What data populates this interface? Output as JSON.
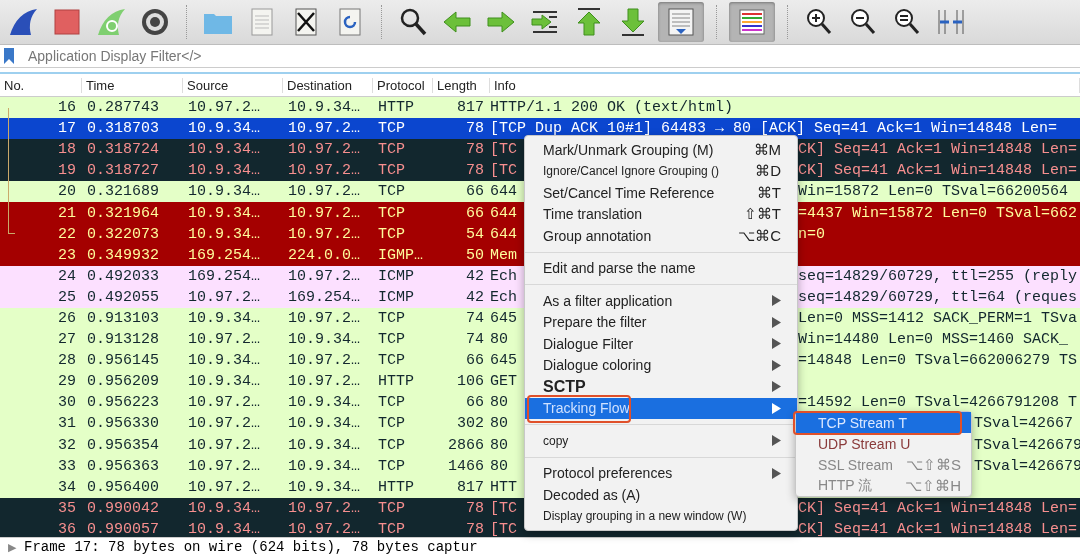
{
  "toolbar": [
    {
      "kind": "shark",
      "pressed": false
    },
    {
      "kind": "stop",
      "pressed": false
    },
    {
      "kind": "restart",
      "pressed": false
    },
    {
      "kind": "gear",
      "pressed": false
    },
    {
      "kind": "sep"
    },
    {
      "kind": "folder",
      "pressed": false
    },
    {
      "kind": "file",
      "pressed": false
    },
    {
      "kind": "close",
      "pressed": false
    },
    {
      "kind": "reload",
      "pressed": false
    },
    {
      "kind": "sep"
    },
    {
      "kind": "search",
      "pressed": false
    },
    {
      "kind": "left",
      "pressed": false
    },
    {
      "kind": "right",
      "pressed": false
    },
    {
      "kind": "goto",
      "pressed": false
    },
    {
      "kind": "top",
      "pressed": false
    },
    {
      "kind": "bottom",
      "pressed": false
    },
    {
      "kind": "autoscroll",
      "pressed": true
    },
    {
      "kind": "sep"
    },
    {
      "kind": "colorize",
      "pressed": true
    },
    {
      "kind": "sep"
    },
    {
      "kind": "zoomin",
      "pressed": false
    },
    {
      "kind": "zoomout",
      "pressed": false
    },
    {
      "kind": "zoomreset",
      "pressed": false
    },
    {
      "kind": "resize",
      "pressed": false
    }
  ],
  "filter": {
    "placeholder": "Application Display Filter</>"
  },
  "columns": [
    "No.",
    "Time",
    "Source",
    "Destination",
    "Protocol",
    "Length",
    "Info"
  ],
  "rows": [
    {
      "kind": "green",
      "related": true,
      "no": "16",
      "time": "0.287743",
      "source": "10.97.2…",
      "destination": "10.9.34…",
      "protocol": "HTTP",
      "length": "817",
      "info": "HTTP/1.1 200 OK  (text/html)"
    },
    {
      "kind": "selected",
      "related": true,
      "no": "17",
      "time": "0.318703",
      "source": "10.9.34…",
      "destination": "10.97.2…",
      "protocol": "TCP",
      "length": "78",
      "info": "[TCP Dup ACK 10#1] 64483 → 80 [ACK] Seq=41 Ack=1 Win=14848 Len="
    },
    {
      "kind": "dark",
      "related": true,
      "no": "18",
      "time": "0.318724",
      "source": "10.9.34…",
      "destination": "10.97.2…",
      "protocol": "TCP",
      "length": "78",
      "info": "[TC",
      "info_tail": "CK] Seq=41 Ack=1 Win=14848 Len="
    },
    {
      "kind": "dark",
      "related": true,
      "no": "19",
      "time": "0.318727",
      "source": "10.9.34…",
      "destination": "10.97.2…",
      "protocol": "TCP",
      "length": "78",
      "info": "[TC",
      "info_tail": "CK] Seq=41 Ack=1 Win=14848 Len="
    },
    {
      "kind": "green",
      "related": true,
      "no": "20",
      "time": "0.321689",
      "source": "10.9.34…",
      "destination": "10.97.2…",
      "protocol": "TCP",
      "length": "66",
      "info": "644",
      "info_tail": "Win=15872 Len=0 TSval=66200564"
    },
    {
      "kind": "red",
      "related": true,
      "no": "21",
      "time": "0.321964",
      "source": "10.9.34…",
      "destination": "10.97.2…",
      "protocol": "TCP",
      "length": "66",
      "info": "644",
      "info_tail": "=4437 Win=15872 Len=0 TSval=662"
    },
    {
      "kind": "red",
      "related": true,
      "no": "22",
      "time": "0.322073",
      "source": "10.9.34…",
      "destination": "10.97.2…",
      "protocol": "TCP",
      "length": "54",
      "info": "644",
      "info_tail": "n=0"
    },
    {
      "kind": "red",
      "no": "23",
      "time": "0.349932",
      "source": "169.254…",
      "destination": "224.0.0…",
      "protocol": "IGMP…",
      "length": "50",
      "info": "Mem"
    },
    {
      "kind": "pink",
      "no": "24",
      "time": "0.492033",
      "source": "169.254…",
      "destination": "10.97.2…",
      "protocol": "ICMP",
      "length": "42",
      "info": "Ech",
      "info_tail": "seq=14829/60729, ttl=255 (reply"
    },
    {
      "kind": "pink",
      "no": "25",
      "time": "0.492055",
      "source": "10.97.2…",
      "destination": "169.254…",
      "protocol": "ICMP",
      "length": "42",
      "info": "Ech",
      "info_tail": "seq=14829/60729, ttl=64 (reques"
    },
    {
      "kind": "green",
      "no": "26",
      "time": "0.913103",
      "source": "10.9.34…",
      "destination": "10.97.2…",
      "protocol": "TCP",
      "length": "74",
      "info": "645",
      "info_tail": "Len=0 MSS=1412 SACK_PERM=1 TSva"
    },
    {
      "kind": "green",
      "no": "27",
      "time": "0.913128",
      "source": "10.97.2…",
      "destination": "10.9.34…",
      "protocol": "TCP",
      "length": "74",
      "info": "80",
      "info_tail": "Win=14480 Len=0 MSS=1460 SACK_"
    },
    {
      "kind": "green",
      "no": "28",
      "time": "0.956145",
      "source": "10.9.34…",
      "destination": "10.97.2…",
      "protocol": "TCP",
      "length": "66",
      "info": "645",
      "info_tail": "=14848 Len=0 TSval=662006279 TS"
    },
    {
      "kind": "green",
      "no": "29",
      "time": "0.956209",
      "source": "10.9.34…",
      "destination": "10.97.2…",
      "protocol": "HTTP",
      "length": "106",
      "info": "GET"
    },
    {
      "kind": "green",
      "no": "30",
      "time": "0.956223",
      "source": "10.97.2…",
      "destination": "10.9.34…",
      "protocol": "TCP",
      "length": "66",
      "info": "80",
      "info_tail": "=14592 Len=0 TSval=4266791208 T"
    },
    {
      "kind": "green",
      "no": "31",
      "time": "0.956330",
      "source": "10.97.2…",
      "destination": "10.9.34…",
      "protocol": "TCP",
      "length": "302",
      "info": "80",
      "info_tail": "TSval=42667"
    },
    {
      "kind": "green",
      "no": "32",
      "time": "0.956354",
      "source": "10.97.2…",
      "destination": "10.9.34…",
      "protocol": "TCP",
      "length": "2866",
      "info": "80",
      "info_tail": "TSval=426679"
    },
    {
      "kind": "green",
      "no": "33",
      "time": "0.956363",
      "source": "10.97.2…",
      "destination": "10.9.34…",
      "protocol": "TCP",
      "length": "1466",
      "info": "80",
      "info_tail": "TSval=426679"
    },
    {
      "kind": "green",
      "no": "34",
      "time": "0.956400",
      "source": "10.97.2…",
      "destination": "10.9.34…",
      "protocol": "HTTP",
      "length": "817",
      "info": "HTT"
    },
    {
      "kind": "dark",
      "no": "35",
      "time": "0.990042",
      "source": "10.9.34…",
      "destination": "10.97.2…",
      "protocol": "TCP",
      "length": "78",
      "info": "[TC",
      "info_tail": "CK] Seq=41 Ack=1 Win=14848 Len="
    },
    {
      "kind": "dark",
      "no": "36",
      "time": "0.990057",
      "source": "10.9.34…",
      "destination": "10.97.2…",
      "protocol": "TCP",
      "length": "78",
      "info": "[TC",
      "info_tail": "CK] Seq=41 Ack=1 Win=14848 Len="
    }
  ],
  "status": {
    "expander": "▶",
    "text": "Frame 17: 78 bytes on wire (624 bits), 78 bytes captur"
  },
  "menu": [
    {
      "kind": "item",
      "label": "Mark/Unmark Grouping (M)",
      "shortcut": "⌘M",
      "submenu": false,
      "selected": false,
      "boxed": false
    },
    {
      "kind": "small",
      "label": "Ignore/Cancel Ignore Grouping ()",
      "shortcut": "⌘D",
      "submenu": false,
      "selected": false,
      "boxed": false
    },
    {
      "kind": "item",
      "label": "Set/Cancel Time Reference",
      "shortcut": "⌘T",
      "submenu": false,
      "selected": false,
      "boxed": false
    },
    {
      "kind": "item",
      "label": "Time translation",
      "shortcut": "⇧⌘T",
      "submenu": false,
      "selected": false,
      "boxed": false
    },
    {
      "kind": "item",
      "label": "Group annotation",
      "shortcut": "⌥⌘C",
      "submenu": false,
      "selected": false,
      "boxed": false
    },
    {
      "kind": "separator"
    },
    {
      "kind": "item",
      "label": "Edit and parse the name",
      "submenu": false,
      "selected": false,
      "boxed": false
    },
    {
      "kind": "separator"
    },
    {
      "kind": "item",
      "label": "As a filter application",
      "submenu": true,
      "selected": false,
      "boxed": false
    },
    {
      "kind": "item",
      "label": "Prepare the filter",
      "submenu": true,
      "selected": false,
      "boxed": false
    },
    {
      "kind": "item",
      "label": "Dialogue Filter",
      "submenu": true,
      "selected": false,
      "boxed": false
    },
    {
      "kind": "item",
      "label": "Dialogue coloring",
      "submenu": true,
      "selected": false,
      "boxed": false
    },
    {
      "kind": "large",
      "label": "SCTP",
      "submenu": true,
      "selected": false,
      "boxed": false
    },
    {
      "kind": "item",
      "label": "Tracking Flow",
      "submenu": true,
      "selected": true,
      "boxed": true
    },
    {
      "kind": "separator"
    },
    {
      "kind": "small",
      "label": "copy",
      "submenu": true,
      "selected": false,
      "boxed": false
    },
    {
      "kind": "separator"
    },
    {
      "kind": "item",
      "label": "Protocol preferences",
      "submenu": true,
      "selected": false,
      "boxed": false
    },
    {
      "kind": "item",
      "label": "Decoded as (A)",
      "submenu": false,
      "selected": false,
      "boxed": false
    },
    {
      "kind": "small",
      "label": "Display grouping in a new window (W)",
      "submenu": false,
      "selected": false,
      "boxed": false
    }
  ],
  "submenu": [
    {
      "label": "TCP Stream T",
      "selected": true,
      "boxed": true,
      "disabled": false
    },
    {
      "label": "UDP Stream U",
      "selected": false,
      "boxed": false,
      "disabled": false
    },
    {
      "label": "SSL Stream",
      "shortcut": "⌥⇧⌘S",
      "selected": false,
      "boxed": false,
      "disabled": true
    },
    {
      "label": "HTTP 流",
      "shortcut": "⌥⇧⌘H",
      "selected": false,
      "boxed": false,
      "disabled": true
    }
  ]
}
